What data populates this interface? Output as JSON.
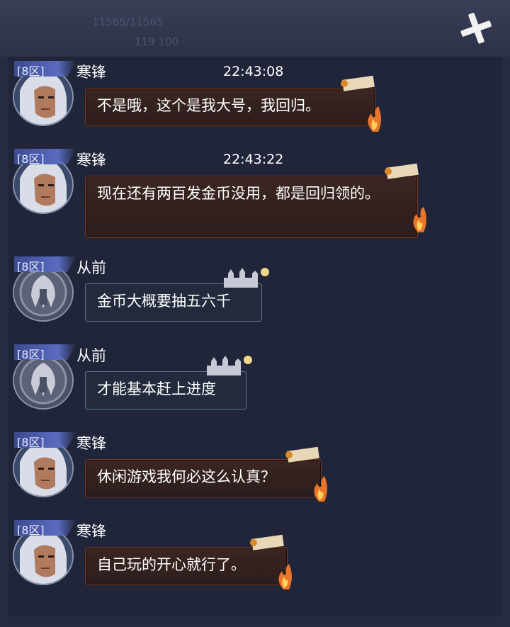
{
  "header": {
    "ghost_line_1": "11565/11565",
    "ghost_line_2": "119 100"
  },
  "messages": [
    {
      "server": "[8区]",
      "name": "寒锋",
      "time": "22:43:08",
      "text": "不是哦，这个是我大号，我回归。",
      "avatar": "white-haired-warrior-avatar",
      "style": "fire"
    },
    {
      "server": "[8区]",
      "name": "寒锋",
      "time": "22:43:22",
      "text": "现在还有两百发金币没用，都是回归领的。",
      "avatar": "white-haired-warrior-avatar",
      "style": "fire"
    },
    {
      "server": "[8区]",
      "name": "从前",
      "time": "",
      "text": "金币大概要抽五六千",
      "avatar": "hooded-emblem-avatar",
      "style": "castle"
    },
    {
      "server": "[8区]",
      "name": "从前",
      "time": "",
      "text": "才能基本赶上进度",
      "avatar": "hooded-emblem-avatar",
      "style": "castle"
    },
    {
      "server": "[8区]",
      "name": "寒锋",
      "time": "",
      "text": "休闲游戏我何必这么认真？",
      "avatar": "white-haired-warrior-avatar",
      "style": "fire"
    },
    {
      "server": "[8区]",
      "name": "寒锋",
      "time": "",
      "text": "自己玩的开心就行了。",
      "avatar": "white-haired-warrior-avatar",
      "style": "fire"
    }
  ],
  "colors": {
    "background": "#262b40",
    "panel": "#20253a",
    "fire_border": "#7a3a22",
    "castle_border": "#5e7392",
    "server_tag": "#5a6bc0"
  },
  "icons": {
    "close": "close-x-icon"
  }
}
